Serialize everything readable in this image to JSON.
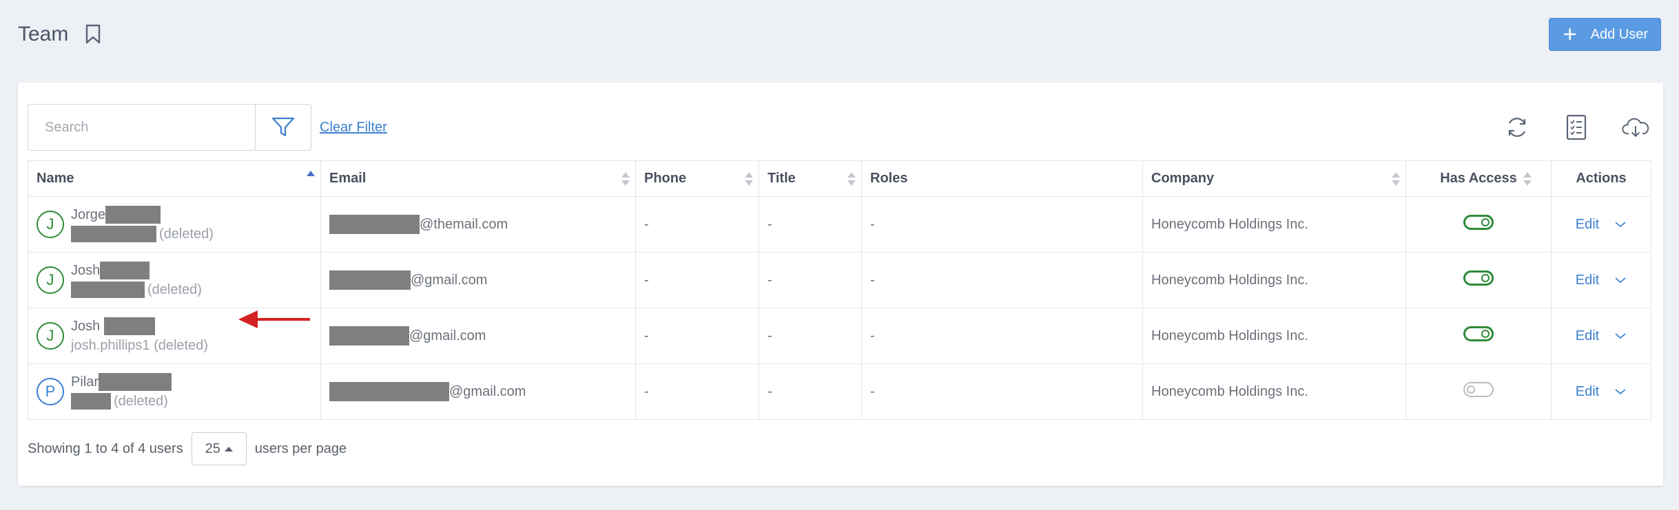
{
  "header": {
    "title": "Team",
    "add_user_label": "Add User",
    "add_user_icon": "plus-icon",
    "bookmark_icon": "bookmark-icon"
  },
  "toolbar": {
    "search_placeholder": "Search",
    "clear_filter_label": "Clear Filter",
    "icons": [
      "filter-icon",
      "refresh-icon",
      "column-list-icon",
      "cloud-download-icon"
    ]
  },
  "table": {
    "columns": [
      "Name",
      "Email",
      "Phone",
      "Title",
      "Roles",
      "Company",
      "Has Access",
      "Actions"
    ],
    "sorted_column": "Name",
    "rows": [
      {
        "initial": "J",
        "first": "Jorge",
        "sub_text": "(deleted)",
        "email_domain": "@themail.com",
        "phone": "-",
        "title": "-",
        "roles": "-",
        "company": "Honeycomb Holdings Inc.",
        "has_access": true,
        "edit": "Edit",
        "avatar_color": "#2e8b3a"
      },
      {
        "initial": "J",
        "first": "Josh",
        "sub_text": "(deleted)",
        "email_domain": "@gmail.com",
        "phone": "-",
        "title": "-",
        "roles": "-",
        "company": "Honeycomb Holdings Inc.",
        "has_access": true,
        "edit": "Edit",
        "avatar_color": "#2e8b3a"
      },
      {
        "initial": "J",
        "first": "Josh",
        "sub_text": "josh.phillips1 (deleted)",
        "email_domain": "@gmail.com",
        "phone": "-",
        "title": "-",
        "roles": "-",
        "company": "Honeycomb Holdings Inc.",
        "has_access": true,
        "edit": "Edit",
        "avatar_color": "#2e8b3a"
      },
      {
        "initial": "P",
        "first": "Pilar",
        "sub_text": "(deleted)",
        "email_domain": "@gmail.com",
        "phone": "-",
        "title": "-",
        "roles": "-",
        "company": "Honeycomb Holdings Inc.",
        "has_access": false,
        "edit": "Edit",
        "avatar_color": "#3a7fd0"
      }
    ]
  },
  "footer": {
    "showing_text": "Showing 1 to 4 of 4 users",
    "per_page_value": "25",
    "per_page_suffix": "users per page"
  },
  "colors": {
    "accent": "#5b9be3",
    "link": "#3a7fd0",
    "access_on": "#2e8b3a",
    "annotation_arrow": "#d42020"
  }
}
